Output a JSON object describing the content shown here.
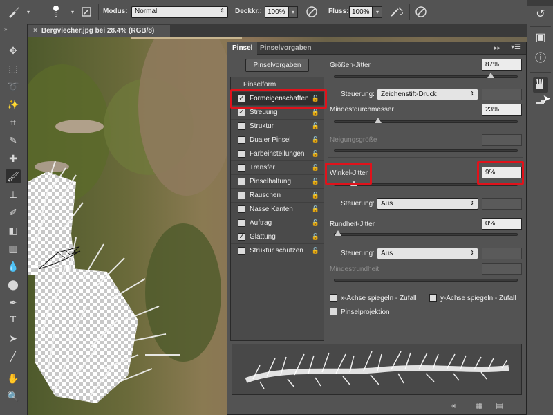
{
  "options_bar": {
    "brush_size": "9",
    "mode_label": "Modus:",
    "mode_value": "Normal",
    "opacity_label": "Deckkr.:",
    "opacity_value": "100%",
    "flow_label": "Fluss:",
    "flow_value": "100%"
  },
  "document": {
    "tab_title": "Bergviecher.jpg bei 28.4% (RGB/8)",
    "close_glyph": "×"
  },
  "brush_panel": {
    "tabs": [
      "Pinsel",
      "Pinselvorgaben"
    ],
    "presets_button": "Pinselvorgaben",
    "list_header": "Pinselform",
    "items": [
      {
        "label": "Formeigenschaften",
        "checked": true,
        "selected": true
      },
      {
        "label": "Streuung",
        "checked": true,
        "selected": false
      },
      {
        "label": "Struktur",
        "checked": false,
        "selected": false
      },
      {
        "label": "Dualer Pinsel",
        "checked": false,
        "selected": false
      },
      {
        "label": "Farbeinstellungen",
        "checked": false,
        "selected": false
      },
      {
        "label": "Transfer",
        "checked": false,
        "selected": false
      },
      {
        "label": "Pinselhaltung",
        "checked": false,
        "selected": false
      },
      {
        "label": "Rauschen",
        "checked": false,
        "selected": false
      },
      {
        "label": "Nasse Kanten",
        "checked": false,
        "selected": false
      },
      {
        "label": "Auftrag",
        "checked": false,
        "selected": false
      },
      {
        "label": "Glättung",
        "checked": true,
        "selected": false
      },
      {
        "label": "Struktur schützen",
        "checked": false,
        "selected": false
      }
    ],
    "size_jitter": {
      "label": "Größen-Jitter",
      "value": "87%",
      "fraction": 0.87
    },
    "size_control": {
      "label": "Steuerung:",
      "value": "Zeichenstift-Druck"
    },
    "min_diameter": {
      "label": "Mindestdurchmesser",
      "value": "23%",
      "fraction": 0.23
    },
    "tilt_scale": {
      "label": "Neigungsgröße"
    },
    "angle_jitter": {
      "label": "Winkel-Jitter",
      "value": "9%",
      "fraction": 0.09
    },
    "angle_control": {
      "label": "Steuerung:",
      "value": "Aus"
    },
    "roundness_jitter": {
      "label": "Rundheit-Jitter",
      "value": "0%",
      "fraction": 0.0
    },
    "roundness_control": {
      "label": "Steuerung:",
      "value": "Aus"
    },
    "min_roundness": {
      "label": "Mindestrundheit"
    },
    "flip_x": {
      "label": "x-Achse spiegeln - Zufall"
    },
    "flip_y": {
      "label": "y-Achse spiegeln - Zufall"
    },
    "brush_projection": {
      "label": "Pinselprojektion"
    }
  },
  "check_glyph": "✓",
  "lock_glyph": "🔓",
  "dropdown_arrow": "⇕"
}
